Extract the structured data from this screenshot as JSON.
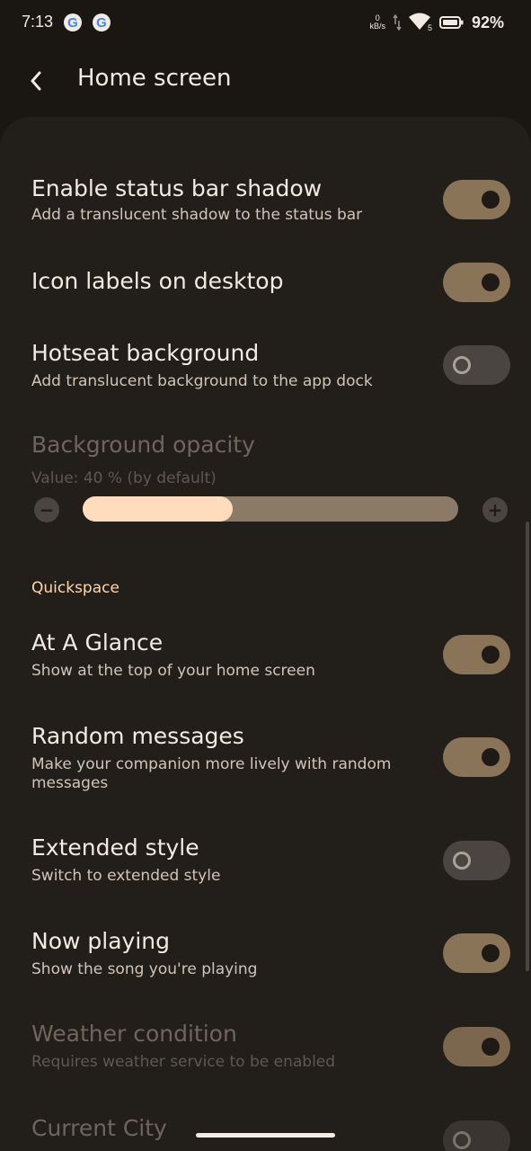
{
  "status_bar": {
    "time": "7:13",
    "notification_icons": [
      "google-icon",
      "google-icon"
    ],
    "network_speed_value": "0",
    "network_speed_unit": "kB/s",
    "wifi_label": "5",
    "battery_percent": "92%"
  },
  "app_bar": {
    "title": "Home screen",
    "back_icon": "chevron-left-icon"
  },
  "settings": [
    {
      "id": "status-bar-shadow",
      "title": "Enable status bar shadow",
      "subtitle": "Add a translucent shadow to the status bar",
      "enabled": true,
      "on": true
    },
    {
      "id": "icon-labels",
      "title": "Icon labels on desktop",
      "subtitle": "",
      "enabled": true,
      "on": true
    },
    {
      "id": "hotseat-background",
      "title": "Hotseat background",
      "subtitle": "Add translucent background to the app dock",
      "enabled": true,
      "on": false
    }
  ],
  "background_opacity": {
    "title": "Background opacity",
    "value_text": "Value: 40 % (by default)",
    "value": 0.4,
    "enabled": false
  },
  "quickspace": {
    "header": "Quickspace",
    "items": [
      {
        "id": "at-a-glance",
        "title": "At A Glance",
        "subtitle": "Show at the top of your home screen",
        "enabled": true,
        "on": true
      },
      {
        "id": "random-messages",
        "title": "Random messages",
        "subtitle": "Make your companion more lively with random messages",
        "enabled": true,
        "on": true
      },
      {
        "id": "extended-style",
        "title": "Extended style",
        "subtitle": "Switch to extended style",
        "enabled": true,
        "on": false
      },
      {
        "id": "now-playing",
        "title": "Now playing",
        "subtitle": "Show the song you're playing",
        "enabled": true,
        "on": true
      },
      {
        "id": "weather-condition",
        "title": "Weather condition",
        "subtitle": "Requires weather service to be enabled",
        "enabled": false,
        "on": true
      },
      {
        "id": "current-city",
        "title": "Current City",
        "subtitle": "",
        "enabled": false,
        "on": false
      }
    ]
  },
  "colors": {
    "background": "#1a1713",
    "sheet": "#221e1a",
    "toggle_on": "#8a7458",
    "toggle_off": "#4a4540",
    "accent": "#ffd6ad",
    "slider_fill": "#ffdcbc"
  }
}
